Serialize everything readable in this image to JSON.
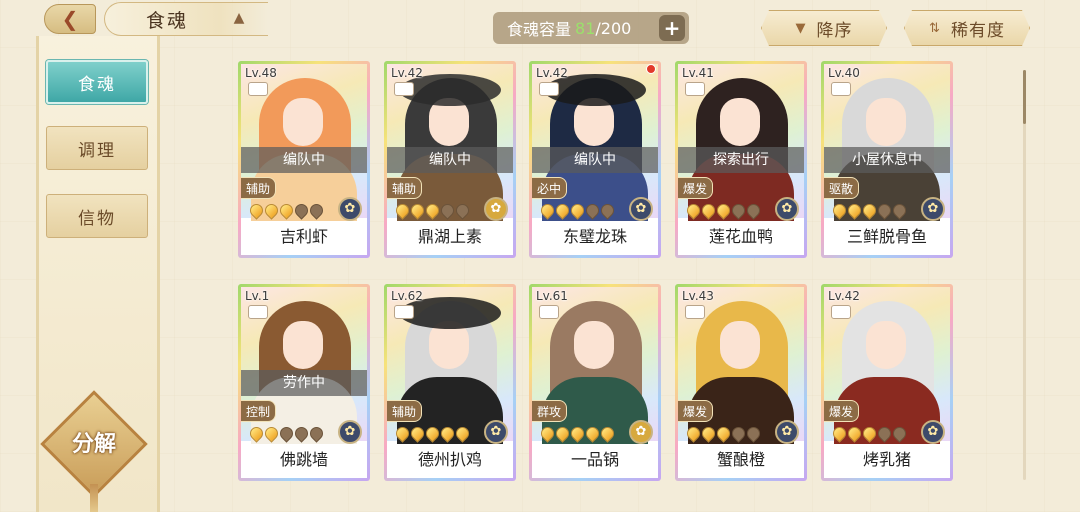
{
  "header": {
    "back_icon": "back-arrow-icon",
    "title": "食魂",
    "capacity_label": "食魂容量",
    "capacity_current": "81",
    "capacity_total": "/200",
    "add_label": "+",
    "sort_order_label": "降序",
    "sort_rarity_label": "稀有度"
  },
  "sidebar": {
    "items": [
      {
        "label": "食魂",
        "active": true
      },
      {
        "label": "调理",
        "active": false
      },
      {
        "label": "信物",
        "active": false
      }
    ],
    "decompose_label": "分解"
  },
  "cards": [
    {
      "level": "Lv.48",
      "status": "编队中",
      "role": "辅助",
      "flames": 3,
      "name": "吉利虾",
      "theme": "orange",
      "new": false
    },
    {
      "level": "Lv.42",
      "status": "编队中",
      "role": "辅助",
      "flames": 3,
      "name": "鼎湖上素",
      "theme": "black-hat",
      "new": false
    },
    {
      "level": "Lv.42",
      "status": "编队中",
      "role": "必中",
      "flames": 3,
      "name": "东璧龙珠",
      "theme": "navy",
      "new": true
    },
    {
      "level": "Lv.41",
      "status": "探索出行",
      "role": "爆发",
      "flames": 3,
      "name": "莲花血鸭",
      "theme": "dark-red",
      "new": false
    },
    {
      "level": "Lv.40",
      "status": "小屋休息中",
      "role": "驱散",
      "flames": 3,
      "name": "三鲜脱骨鱼",
      "theme": "silver",
      "new": false
    },
    {
      "level": "Lv.1",
      "status": "劳作中",
      "role": "控制",
      "flames": 2,
      "name": "佛跳墙",
      "theme": "brown",
      "new": false
    },
    {
      "level": "Lv.62",
      "status": "",
      "role": "辅助",
      "flames": 5,
      "name": "德州扒鸡",
      "theme": "military",
      "new": false
    },
    {
      "level": "Lv.61",
      "status": "",
      "role": "群攻",
      "flames": 5,
      "name": "一品锅",
      "theme": "green",
      "new": false
    },
    {
      "level": "Lv.43",
      "status": "",
      "role": "爆发",
      "flames": 3,
      "name": "蟹酿橙",
      "theme": "gold",
      "new": false
    },
    {
      "level": "Lv.42",
      "status": "",
      "role": "爆发",
      "flames": 3,
      "name": "烤乳猪",
      "theme": "red-white",
      "new": false
    }
  ],
  "colors": {
    "accent_teal": "#3fa7a6",
    "capacity_current": "#9be06c",
    "status_band": "#5c5c5c"
  }
}
